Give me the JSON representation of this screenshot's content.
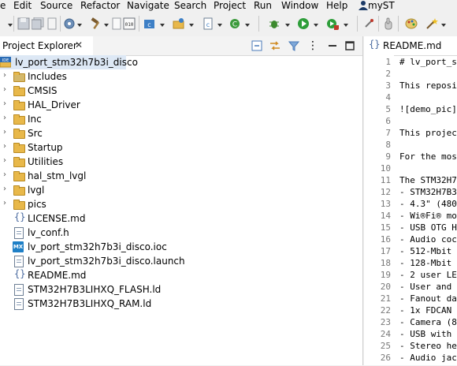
{
  "menu": [
    "e",
    "Edit",
    "Source",
    "Refactor",
    "Navigate",
    "Search",
    "Project",
    "Run",
    "Window",
    "Help"
  ],
  "user": "myST",
  "explorer": {
    "tab_label": "Project Explorer",
    "tab_close": "✕",
    "project": "lv_port_stm32h7b3i_disco",
    "project_badge": "IDE",
    "items": [
      {
        "label": "Includes",
        "kind": "includes",
        "expandable": true
      },
      {
        "label": "CMSIS",
        "kind": "folder",
        "expandable": true
      },
      {
        "label": "HAL_Driver",
        "kind": "folder",
        "expandable": true
      },
      {
        "label": "Inc",
        "kind": "folder",
        "expandable": true
      },
      {
        "label": "Src",
        "kind": "folder",
        "expandable": true
      },
      {
        "label": "Startup",
        "kind": "folder",
        "expandable": true
      },
      {
        "label": "Utilities",
        "kind": "folder",
        "expandable": true
      },
      {
        "label": "hal_stm_lvgl",
        "kind": "folder",
        "expandable": true
      },
      {
        "label": "lvgl",
        "kind": "folder",
        "expandable": true
      },
      {
        "label": "pics",
        "kind": "folder",
        "expandable": true
      },
      {
        "label": "LICENSE.md",
        "kind": "markdown",
        "expandable": false
      },
      {
        "label": "lv_conf.h",
        "kind": "file",
        "expandable": false
      },
      {
        "label": "lv_port_stm32h7b3i_disco.ioc",
        "kind": "mx",
        "expandable": false
      },
      {
        "label": "lv_port_stm32h7b3i_disco.launch",
        "kind": "file",
        "expandable": false
      },
      {
        "label": "README.md",
        "kind": "markdown",
        "expandable": false
      },
      {
        "label": "STM32H7B3LIHXQ_FLASH.ld",
        "kind": "file",
        "expandable": false
      },
      {
        "label": "STM32H7B3LIHXQ_RAM.ld",
        "kind": "file",
        "expandable": false
      }
    ]
  },
  "editor": {
    "tab_label": "README.md",
    "lines": [
      {
        "n": "1",
        "text": "# lv_port_s"
      },
      {
        "n": "2",
        "text": ""
      },
      {
        "n": "3",
        "text": "This reposi"
      },
      {
        "n": "4",
        "text": ""
      },
      {
        "n": "5",
        "text": "![demo_pic]"
      },
      {
        "n": "6",
        "text": ""
      },
      {
        "n": "7",
        "text": "This projec"
      },
      {
        "n": "8",
        "text": ""
      },
      {
        "n": "9",
        "text": "For the mos"
      },
      {
        "n": "10",
        "text": ""
      },
      {
        "n": "11",
        "text": "The STM32H7"
      },
      {
        "n": "12",
        "text": "- STM32H7B3"
      },
      {
        "n": "13",
        "text": "- 4.3\" (480"
      },
      {
        "n": "14",
        "text": "- Wi®Fi® mo"
      },
      {
        "n": "15",
        "text": "- USB OTG H"
      },
      {
        "n": "16",
        "text": "- Audio coc"
      },
      {
        "n": "17",
        "text": "- 512-Mbit"
      },
      {
        "n": "18",
        "text": "- 128-Mbit"
      },
      {
        "n": "19",
        "text": "- 2 user LE"
      },
      {
        "n": "20",
        "text": "- User and"
      },
      {
        "n": "21",
        "text": "- Fanout da"
      },
      {
        "n": "22",
        "text": "- 1x FDCAN"
      },
      {
        "n": "23",
        "text": "- Camera (8"
      },
      {
        "n": "24",
        "text": "- USB with"
      },
      {
        "n": "25",
        "text": "- Stereo he"
      },
      {
        "n": "26",
        "text": "- Audio jac"
      }
    ]
  },
  "colors": {
    "selection": "#dde8f5",
    "folder": "#e8b84a",
    "mx_badge": "#1e7fc6",
    "run_green": "#2e9e3a",
    "debug_green": "#3c8a2e"
  },
  "icons": {
    "run": "play-icon",
    "debug": "bug-icon",
    "save": "save-icon",
    "build": "hammer-icon"
  }
}
